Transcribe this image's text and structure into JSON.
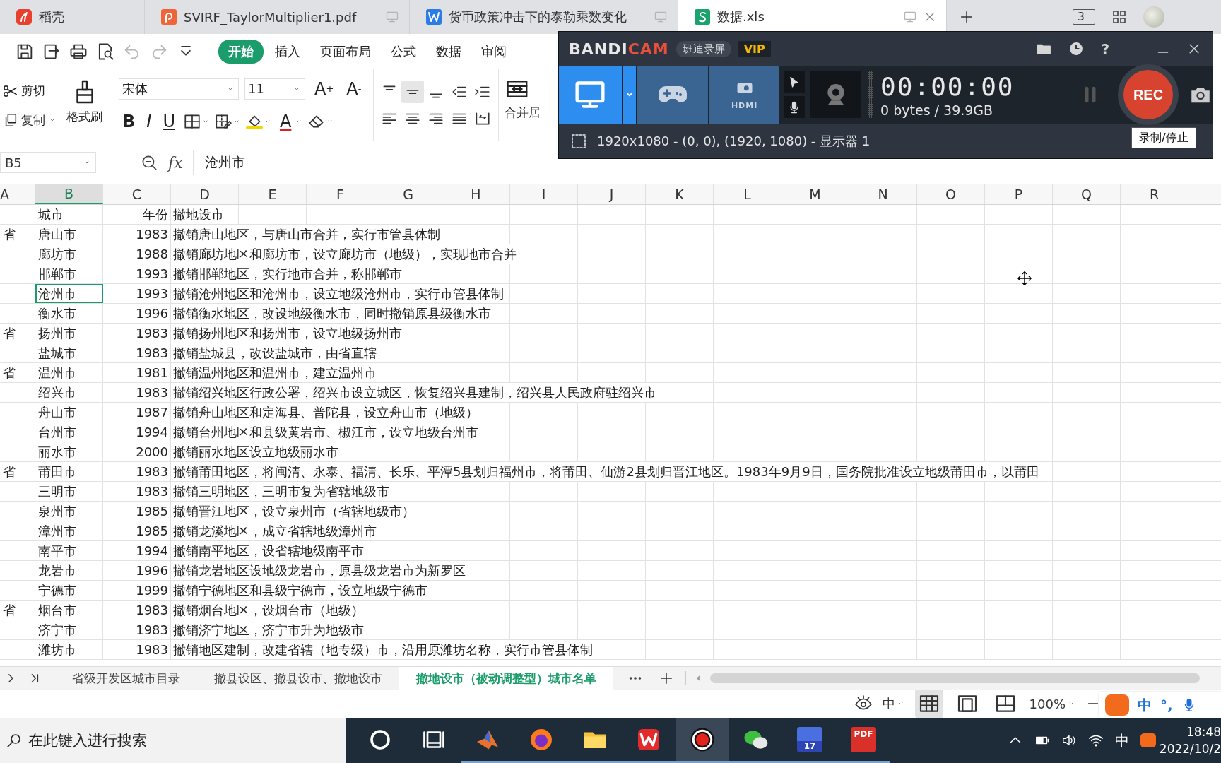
{
  "browser_tabs": [
    {
      "kind": "docer",
      "title": "稻壳",
      "selected": false
    },
    {
      "kind": "pdf",
      "title": "SVIRF_TaylorMultiplier1.pdf",
      "selected": false
    },
    {
      "kind": "word",
      "title": "货币政策冲击下的泰勒乘数变化",
      "selected": false
    },
    {
      "kind": "sheet",
      "title": "数据.xls",
      "selected": true
    }
  ],
  "window_count": "3",
  "quick_tools": [
    {
      "kind": "save",
      "disabled": false
    },
    {
      "kind": "export",
      "disabled": false
    },
    {
      "kind": "print",
      "disabled": false
    },
    {
      "kind": "preview",
      "disabled": false
    },
    {
      "kind": "undo",
      "disabled": true
    },
    {
      "kind": "redo",
      "disabled": true
    },
    {
      "kind": "more",
      "disabled": false
    }
  ],
  "menu_tabs": [
    {
      "label": "开始",
      "selected": true
    },
    {
      "label": "插入",
      "selected": false
    },
    {
      "label": "页面布局",
      "selected": false
    },
    {
      "label": "公式",
      "selected": false
    },
    {
      "label": "数据",
      "selected": false
    },
    {
      "label": "审阅",
      "selected": false
    }
  ],
  "ribbon": {
    "cut": "剪切",
    "copy": "复制",
    "format_painter": "格式刷",
    "font": "宋体",
    "font_size": "11",
    "grow": "A$^{+}$",
    "shrink": "A$^{-}$",
    "bold": "B",
    "italic": "I",
    "underline": "U",
    "font_color": "A",
    "merge": "合并居"
  },
  "formula_bar": {
    "cell": "B5",
    "fx": "fx",
    "value": "沧州市"
  },
  "columns": [
    {
      "label": "A",
      "selected": false
    },
    {
      "label": "B",
      "selected": true
    },
    {
      "label": "C",
      "selected": false
    },
    {
      "label": "D",
      "selected": false
    },
    {
      "label": "E",
      "selected": false
    },
    {
      "label": "F",
      "selected": false
    },
    {
      "label": "G",
      "selected": false
    },
    {
      "label": "H",
      "selected": false
    },
    {
      "label": "I",
      "selected": false
    },
    {
      "label": "J",
      "selected": false
    },
    {
      "label": "K",
      "selected": false
    },
    {
      "label": "L",
      "selected": false
    },
    {
      "label": "M",
      "selected": false
    },
    {
      "label": "N",
      "selected": false
    },
    {
      "label": "O",
      "selected": false
    },
    {
      "label": "P",
      "selected": false
    },
    {
      "label": "Q",
      "selected": false
    },
    {
      "label": "R",
      "selected": false
    }
  ],
  "header_row": {
    "city": "城市",
    "year": "年份",
    "note": "撤地设市"
  },
  "rows": [
    {
      "province": "省",
      "city": "唐山市",
      "year": "1983",
      "note": "撤销唐山地区，与唐山市合并，实行市管县体制",
      "selected": false
    },
    {
      "city": "廊坊市",
      "year": "1988",
      "note": "撤销廊坊地区和廊坊市，设立廊坊市（地级），实现地市合并",
      "selected": false
    },
    {
      "city": "邯郸市",
      "year": "1993",
      "note": "撤销邯郸地区，实行地市合并，称邯郸市",
      "selected": false
    },
    {
      "city": "沧州市",
      "year": "1993",
      "note": "撤销沧州地区和沧州市，设立地级沧州市，实行市管县体制",
      "selected": true
    },
    {
      "city": "衡水市",
      "year": "1996",
      "note": "撤销衡水地区，改设地级衡水市，同时撤销原县级衡水市",
      "selected": false
    },
    {
      "province": "省",
      "city": "扬州市",
      "year": "1983",
      "note": "撤销扬州地区和扬州市，设立地级扬州市",
      "selected": false
    },
    {
      "city": "盐城市",
      "year": "1983",
      "note": "撤销盐城县，改设盐城市，由省直辖",
      "selected": false
    },
    {
      "province": "省",
      "city": "温州市",
      "year": "1981",
      "note": "撤销温州地区和温州市，建立温州市",
      "selected": false
    },
    {
      "city": "绍兴市",
      "year": "1983",
      "note": "撤销绍兴地区行政公署，绍兴市设立城区，恢复绍兴县建制，绍兴县人民政府驻绍兴市",
      "selected": false
    },
    {
      "city": "舟山市",
      "year": "1987",
      "note": "撤销舟山地区和定海县、普陀县，设立舟山市（地级）",
      "selected": false
    },
    {
      "city": "台州市",
      "year": "1994",
      "note": "撤销台州地区和县级黄岩市、椒江市，设立地级台州市",
      "selected": false
    },
    {
      "city": "丽水市",
      "year": "2000",
      "note": "撤销丽水地区设立地级丽水市",
      "selected": false
    },
    {
      "province": "省",
      "city": "莆田市",
      "year": "1983",
      "note": "撤销莆田地区，将闽清、永泰、福清、长乐、平潭5县划归福州市，将莆田、仙游2县划归晋江地区。1983年9月9日，国务院批准设立地级莆田市，以莆田",
      "selected": false
    },
    {
      "city": "三明市",
      "year": "1983",
      "note": "撤销三明地区，三明市复为省辖地级市",
      "selected": false
    },
    {
      "city": "泉州市",
      "year": "1985",
      "note": "撤销晋江地区，设立泉州市（省辖地级市）",
      "selected": false
    },
    {
      "city": "漳州市",
      "year": "1985",
      "note": "撤销龙溪地区，成立省辖地级漳州市",
      "selected": false
    },
    {
      "city": "南平市",
      "year": "1994",
      "note": "撤销南平地区，设省辖地级南平市",
      "selected": false
    },
    {
      "city": "龙岩市",
      "year": "1996",
      "note": "撤销龙岩地区设地级龙岩市，原县级龙岩市为新罗区",
      "selected": false
    },
    {
      "city": "宁德市",
      "year": "1999",
      "note": "撤销宁德地区和县级宁德市，设立地级宁德市",
      "selected": false
    },
    {
      "province": "省",
      "city": "烟台市",
      "year": "1983",
      "note": "撤销烟台地区，设烟台市（地级）",
      "selected": false
    },
    {
      "city": "济宁市",
      "year": "1983",
      "note": "撤销济宁地区，济宁市升为地级市",
      "selected": false
    },
    {
      "city": "潍坊市",
      "year": "1983",
      "note": "撤销地区建制，改建省辖（地专级）市，沿用原潍坊名称，实行市管县体制",
      "selected": false
    }
  ],
  "sheet_tabs": [
    {
      "label": "省级开发区城市目录",
      "selected": false
    },
    {
      "label": "撤县设区、撤县设市、撤地设市",
      "selected": false
    },
    {
      "label": "撤地设市（被动调整型）城市名单",
      "selected": true
    }
  ],
  "status_bar": {
    "input_mode": "中",
    "views": [
      {
        "kind": "normal",
        "selected": true
      },
      {
        "kind": "page",
        "selected": false
      },
      {
        "kind": "break",
        "selected": false
      }
    ],
    "zoom": "100%"
  },
  "ime_bar": {
    "mode": "中",
    "punctuation": "°,"
  },
  "bandicam": {
    "logo_main": "BANDI",
    "logo_accent": "CAM",
    "brand": "班迪录屏",
    "vip": "VIP",
    "help": "?",
    "modes": [
      {
        "kind": "screen",
        "selected": true
      },
      {
        "kind": "game",
        "selected": false
      },
      {
        "kind": "hdmi",
        "label": "HDMI",
        "selected": false
      }
    ],
    "timer": "00:00:00",
    "size": "0 bytes / 39.9GB",
    "rec": "REC",
    "area": "1920x1080 - (0, 0), (1920, 1080) - 显示器 1",
    "tooltip": "录制/停止"
  },
  "taskbar": {
    "search_placeholder": "在此键入进行搜索",
    "apps": [
      {
        "kind": "cortana",
        "selected": false,
        "running": false
      },
      {
        "kind": "taskview",
        "selected": false,
        "running": false
      },
      {
        "kind": "matlab",
        "selected": false,
        "running": true
      },
      {
        "kind": "firefox",
        "selected": false,
        "running": true
      },
      {
        "kind": "explorer",
        "selected": false,
        "running": true
      },
      {
        "kind": "wps",
        "selected": false,
        "running": true
      },
      {
        "kind": "recorder",
        "selected": true,
        "running": true
      },
      {
        "kind": "wechat",
        "selected": false,
        "running": true
      },
      {
        "kind": "calendar",
        "label": "17",
        "selected": false,
        "running": true
      },
      {
        "kind": "pdf",
        "label": "PDF",
        "selected": false,
        "running": true
      }
    ],
    "ime": "中",
    "time": "18:48",
    "date": "2022/10/2"
  }
}
